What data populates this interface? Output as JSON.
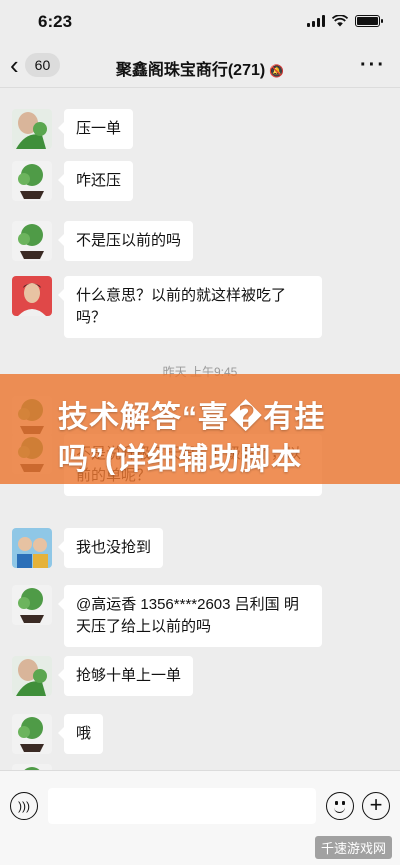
{
  "status_bar": {
    "time": "6:23"
  },
  "header": {
    "back_count": "60",
    "title": "聚鑫阁珠宝商行(271)",
    "mute_symbol": "🔕",
    "more_label": "···"
  },
  "messages": [
    {
      "text": "压一单",
      "avatar": "avatar-woman-plant"
    },
    {
      "text": "咋还压",
      "avatar": "avatar-plant"
    },
    {
      "text": "不是压以前的吗",
      "avatar": "avatar-plant"
    },
    {
      "text": "什么意思？以前的就这样被吃了吗？",
      "avatar": "avatar-man-portrait"
    },
    {
      "text": "不是说升级三天吗，升级完了，以前的单呢？",
      "avatar": "avatar-plant"
    },
    {
      "text": "我也没抢到",
      "avatar": "avatar-kids-photo"
    },
    {
      "text": "@高运香 1356****2603 吕利国 明天压了给上以前的吗",
      "avatar": "avatar-plant"
    },
    {
      "text": "抢够十单上一单",
      "avatar": "avatar-woman-plant"
    },
    {
      "text": "哦",
      "avatar": "avatar-plant"
    }
  ],
  "timestamp": "昨天 上午9:45",
  "overlay": {
    "line1": "技术解答“喜�有挂",
    "line2": "吗”(详细辅助脚本"
  },
  "watermark": "千速游戏网",
  "colors": {
    "background": "#ededed",
    "bubble": "#ffffff",
    "overlay": "#eb7832"
  }
}
